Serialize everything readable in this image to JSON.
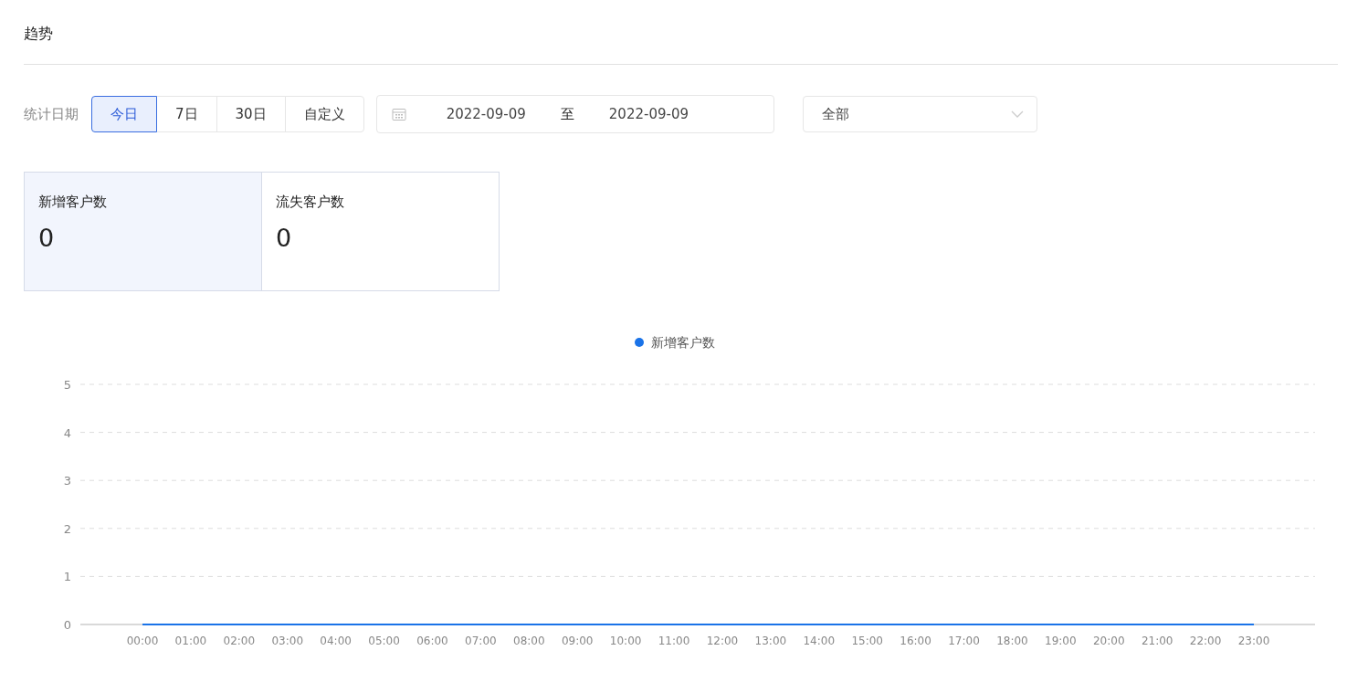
{
  "section_title": "趋势",
  "filters": {
    "label": "统计日期",
    "ranges": [
      {
        "label": "今日",
        "selected": true
      },
      {
        "label": "7日",
        "selected": false
      },
      {
        "label": "30日",
        "selected": false
      },
      {
        "label": "自定义",
        "selected": false
      }
    ],
    "date_range": {
      "start": "2022-09-09",
      "separator": "至",
      "end": "2022-09-09"
    },
    "select": {
      "value": "全部"
    }
  },
  "stats": [
    {
      "label": "新增客户数",
      "value": "0",
      "selected": true
    },
    {
      "label": "流失客户数",
      "value": "0",
      "selected": false
    }
  ],
  "chart_data": {
    "type": "line",
    "categories": [
      "00:00",
      "01:00",
      "02:00",
      "03:00",
      "04:00",
      "05:00",
      "06:00",
      "07:00",
      "08:00",
      "09:00",
      "10:00",
      "11:00",
      "12:00",
      "13:00",
      "14:00",
      "15:00",
      "16:00",
      "17:00",
      "18:00",
      "19:00",
      "20:00",
      "21:00",
      "22:00",
      "23:00"
    ],
    "series": [
      {
        "name": "新增客户数",
        "color": "#1a73e8",
        "values": [
          0,
          0,
          0,
          0,
          0,
          0,
          0,
          0,
          0,
          0,
          0,
          0,
          0,
          0,
          0,
          0,
          0,
          0,
          0,
          0,
          0,
          0,
          0,
          0
        ]
      }
    ],
    "ylim": [
      0,
      5
    ],
    "yticks": [
      0,
      1,
      2,
      3,
      4,
      5
    ],
    "grid": true
  }
}
